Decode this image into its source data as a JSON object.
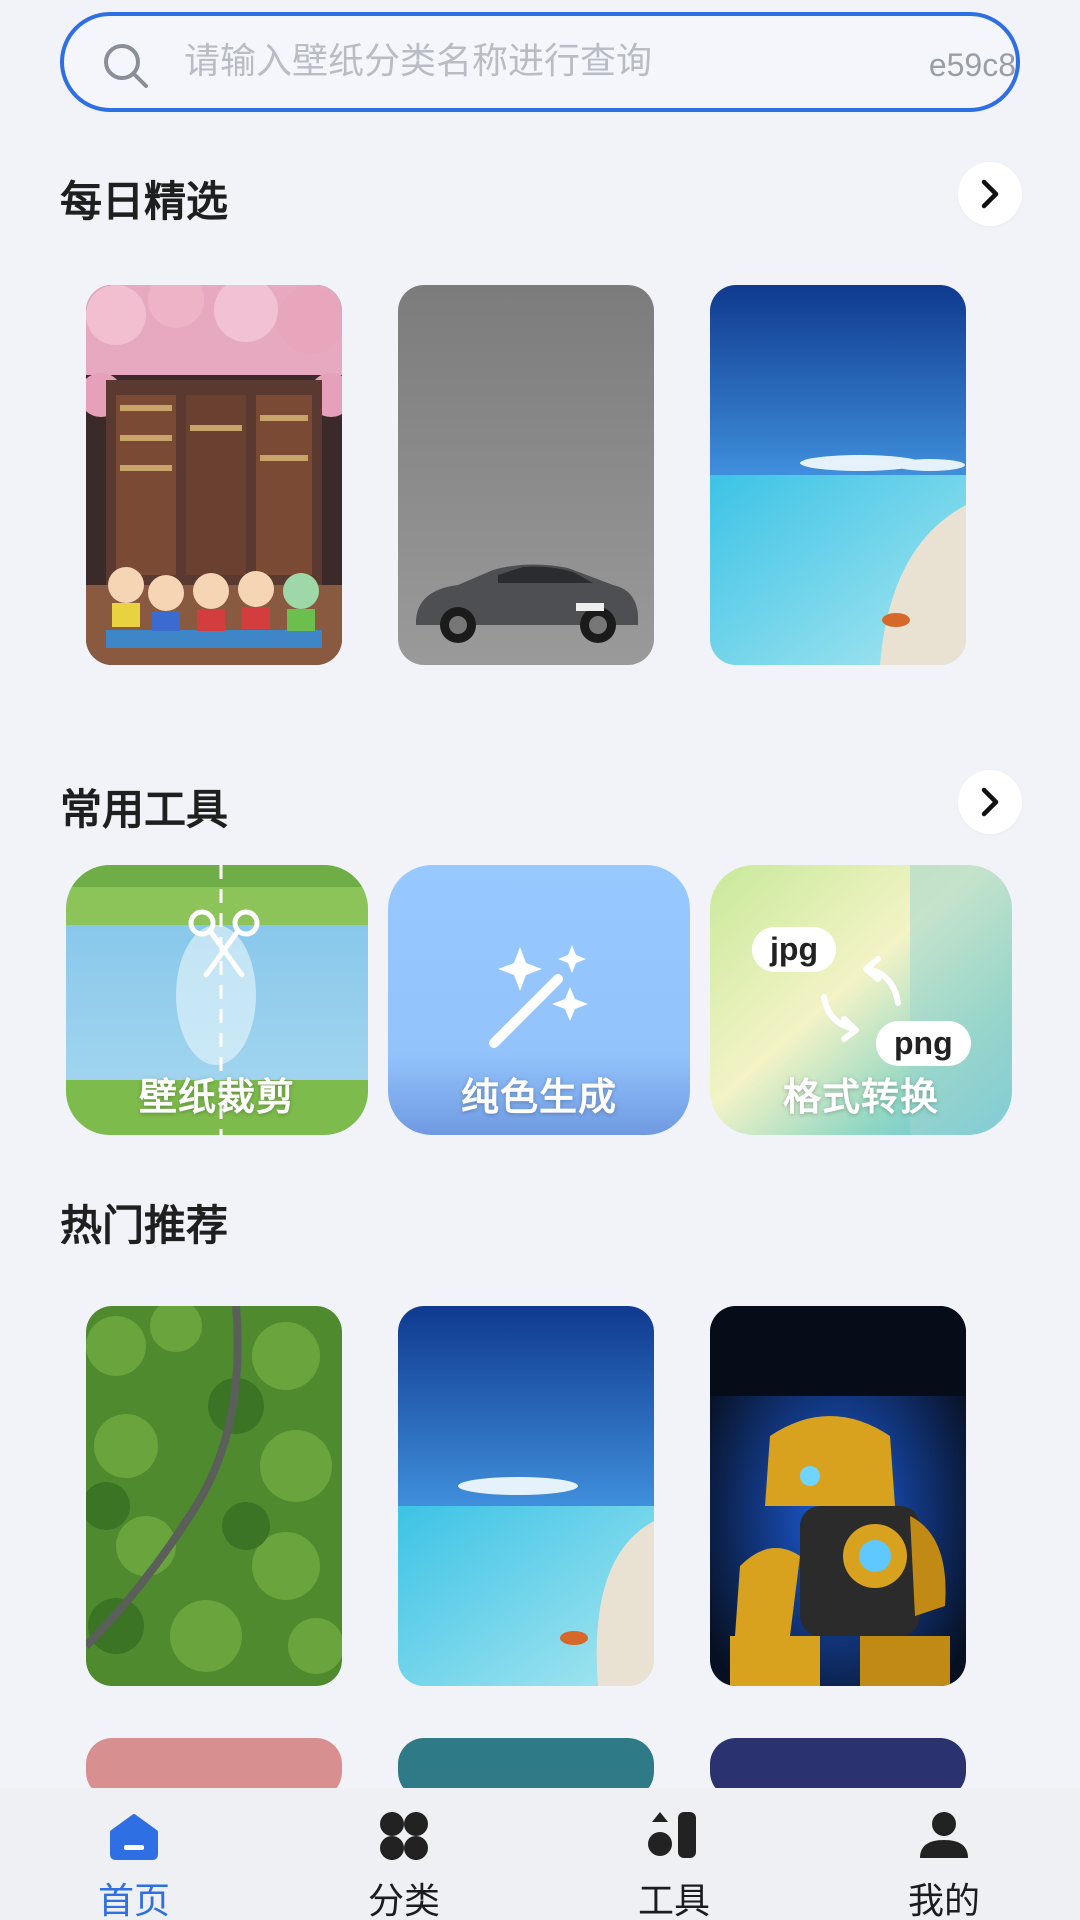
{
  "search": {
    "placeholder": "请输入壁纸分类名称进行查询",
    "code": "e59c8"
  },
  "sections": {
    "daily": {
      "title": "每日精选"
    },
    "tools": {
      "title": "常用工具"
    },
    "hot": {
      "title": "热门推荐"
    }
  },
  "daily_picks": [
    {
      "name": "cartoon-bookstore-wallpaper"
    },
    {
      "name": "grey-car-wallpaper"
    },
    {
      "name": "blue-beach-wallpaper"
    }
  ],
  "tools": [
    {
      "label": "壁纸裁剪"
    },
    {
      "label": "纯色生成"
    },
    {
      "label": "格式转换",
      "chip_from": "jpg",
      "chip_to": "png"
    }
  ],
  "hot": [
    {
      "name": "forest-road-wallpaper"
    },
    {
      "name": "beach-wallpaper"
    },
    {
      "name": "robot-wallpaper"
    }
  ],
  "nav": [
    {
      "label": "首页",
      "icon": "home-icon",
      "active": true
    },
    {
      "label": "分类",
      "icon": "category-icon",
      "active": false
    },
    {
      "label": "工具",
      "icon": "tools-icon",
      "active": false
    },
    {
      "label": "我的",
      "icon": "profile-icon",
      "active": false
    }
  ],
  "colors": {
    "accent": "#2f6fe4",
    "background": "#f1f3f8"
  }
}
